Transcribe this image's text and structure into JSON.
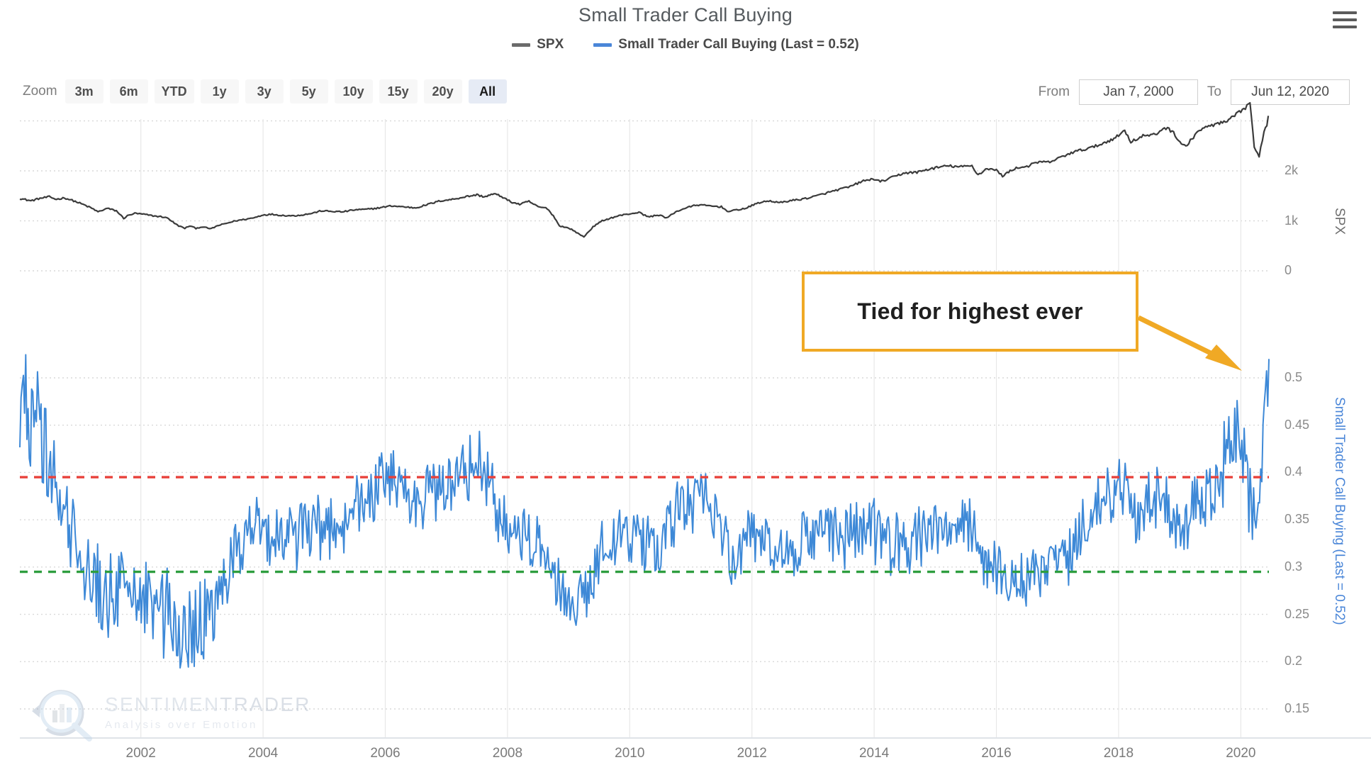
{
  "header": {
    "title": "Small Trader Call Buying",
    "menu_icon": "hamburger-menu-icon"
  },
  "legend": {
    "items": [
      {
        "label": "SPX",
        "color": "#6b6b6b"
      },
      {
        "label": "Small Trader Call Buying (Last = 0.52)",
        "color": "#4a86d8"
      }
    ]
  },
  "toolbar": {
    "zoom_label": "Zoom",
    "zoom_options": [
      "3m",
      "6m",
      "YTD",
      "1y",
      "3y",
      "5y",
      "10y",
      "15y",
      "20y",
      "All"
    ],
    "zoom_selected": "All",
    "from_label": "From",
    "from_value": "Jan 7, 2000",
    "to_label": "To",
    "to_value": "Jun 12, 2020"
  },
  "annotation": {
    "text": "Tied for highest ever",
    "border_color": "#f0a925",
    "arrow_color": "#f0a925"
  },
  "watermark": {
    "brand_first": "SENTIMEN",
    "brand_second": "TRADER",
    "tagline": "Analysis over Emotion"
  },
  "chart_data": {
    "type": "line",
    "title": "Small Trader Call Buying",
    "xlabel": "",
    "grid": true,
    "legend_position": "top-center",
    "x_axis": {
      "start": "2000-01-07",
      "end": "2020-06-12",
      "tick_labels": [
        "2002",
        "2004",
        "2006",
        "2008",
        "2010",
        "2012",
        "2014",
        "2016",
        "2018",
        "2020"
      ],
      "tick_years": [
        2002,
        2004,
        2006,
        2008,
        2010,
        2012,
        2014,
        2016,
        2018,
        2020
      ]
    },
    "panels": [
      {
        "name": "spx-panel",
        "ylabel": "SPX",
        "ylabel_color": "#6e6e6e",
        "ytick_labels": [
          "2k",
          "1k",
          "0"
        ],
        "ytick_values": [
          2000,
          1000,
          0
        ],
        "ylim": [
          0,
          3600
        ],
        "series": [
          {
            "name": "SPX",
            "color": "#3b3b3b",
            "x": [
              2000.02,
              2000.2,
              2000.35,
              2000.5,
              2000.62,
              2000.75,
              2000.9,
              2001.05,
              2001.2,
              2001.3,
              2001.45,
              2001.6,
              2001.72,
              2001.78,
              2001.9,
              2002.05,
              2002.2,
              2002.35,
              2002.45,
              2002.55,
              2002.62,
              2002.72,
              2002.8,
              2002.9,
              2003.0,
              2003.15,
              2003.25,
              2003.4,
              2003.55,
              2003.7,
              2003.85,
              2004.0,
              2004.15,
              2004.3,
              2004.5,
              2004.65,
              2004.8,
              2004.95,
              2005.1,
              2005.3,
              2005.5,
              2005.7,
              2005.9,
              2006.1,
              2006.3,
              2006.5,
              2006.7,
              2006.9,
              2007.1,
              2007.3,
              2007.5,
              2007.62,
              2007.78,
              2007.9,
              2008.05,
              2008.2,
              2008.35,
              2008.5,
              2008.65,
              2008.75,
              2008.85,
              2008.95,
              2009.05,
              2009.15,
              2009.25,
              2009.4,
              2009.55,
              2009.7,
              2009.85,
              2010.0,
              2010.15,
              2010.3,
              2010.5,
              2010.6,
              2010.75,
              2010.9,
              2011.1,
              2011.3,
              2011.5,
              2011.62,
              2011.75,
              2011.9,
              2012.1,
              2012.3,
              2012.45,
              2012.6,
              2012.8,
              2013.0,
              2013.2,
              2013.4,
              2013.6,
              2013.8,
              2014.0,
              2014.1,
              2014.3,
              2014.5,
              2014.7,
              2014.85,
              2015.0,
              2015.2,
              2015.4,
              2015.6,
              2015.7,
              2015.85,
              2016.0,
              2016.1,
              2016.3,
              2016.5,
              2016.7,
              2016.85,
              2017.0,
              2017.2,
              2017.4,
              2017.6,
              2017.8,
              2018.0,
              2018.1,
              2018.2,
              2018.4,
              2018.6,
              2018.75,
              2018.9,
              2018.98,
              2019.1,
              2019.3,
              2019.5,
              2019.6,
              2019.75,
              2019.9,
              2020.05,
              2020.15,
              2020.22,
              2020.3,
              2020.38,
              2020.45
            ],
            "y": [
              1450,
              1400,
              1450,
              1480,
              1430,
              1460,
              1400,
              1330,
              1250,
              1180,
              1250,
              1200,
              1050,
              1100,
              1150,
              1130,
              1100,
              1080,
              1050,
              950,
              900,
              850,
              900,
              850,
              880,
              840,
              900,
              950,
              1000,
              1030,
              1060,
              1120,
              1130,
              1110,
              1100,
              1120,
              1150,
              1200,
              1190,
              1180,
              1220,
              1230,
              1260,
              1300,
              1280,
              1260,
              1330,
              1400,
              1430,
              1480,
              1520,
              1480,
              1540,
              1490,
              1380,
              1330,
              1390,
              1280,
              1250,
              1100,
              900,
              870,
              830,
              750,
              680,
              880,
              1000,
              1060,
              1110,
              1140,
              1170,
              1080,
              1120,
              1050,
              1180,
              1250,
              1320,
              1300,
              1280,
              1180,
              1220,
              1250,
              1360,
              1400,
              1360,
              1400,
              1430,
              1480,
              1550,
              1620,
              1680,
              1790,
              1840,
              1780,
              1870,
              1960,
              1970,
              2020,
              2060,
              2100,
              2080,
              2100,
              1920,
              2050,
              2010,
              1900,
              2050,
              2090,
              2180,
              2170,
              2240,
              2350,
              2420,
              2480,
              2580,
              2700,
              2820,
              2580,
              2700,
              2720,
              2870,
              2780,
              2600,
              2480,
              2800,
              2900,
              2940,
              2970,
              3100,
              3230,
              3380,
              2450,
              2300,
              2800,
              2950,
              3100
            ]
          }
        ]
      },
      {
        "name": "small-trader-call-buying-panel",
        "ylabel": "Small Trader Call Buying (Last = 0.52)",
        "ylabel_color": "#4a86d8",
        "ytick_labels": [
          "0.5",
          "0.45",
          "0.4",
          "0.35",
          "0.3",
          "0.25",
          "0.2",
          "0.15"
        ],
        "ytick_values": [
          0.5,
          0.45,
          0.4,
          0.35,
          0.3,
          0.25,
          0.2,
          0.15
        ],
        "ylim": [
          0.13,
          0.535
        ],
        "last_value": 0.52,
        "reference_lines": [
          {
            "name": "upper-threshold",
            "value": 0.395,
            "color": "#e8403a",
            "style": "dashed"
          },
          {
            "name": "lower-threshold",
            "value": 0.295,
            "color": "#2e9e3f",
            "style": "dashed"
          }
        ],
        "series": [
          {
            "name": "Small Trader Call Buying",
            "color": "#2e7fd4",
            "note": "weekly values 2000-01-07 through 2020-06-12; dense jagged series, range 0.18-0.53"
          }
        ]
      }
    ]
  }
}
